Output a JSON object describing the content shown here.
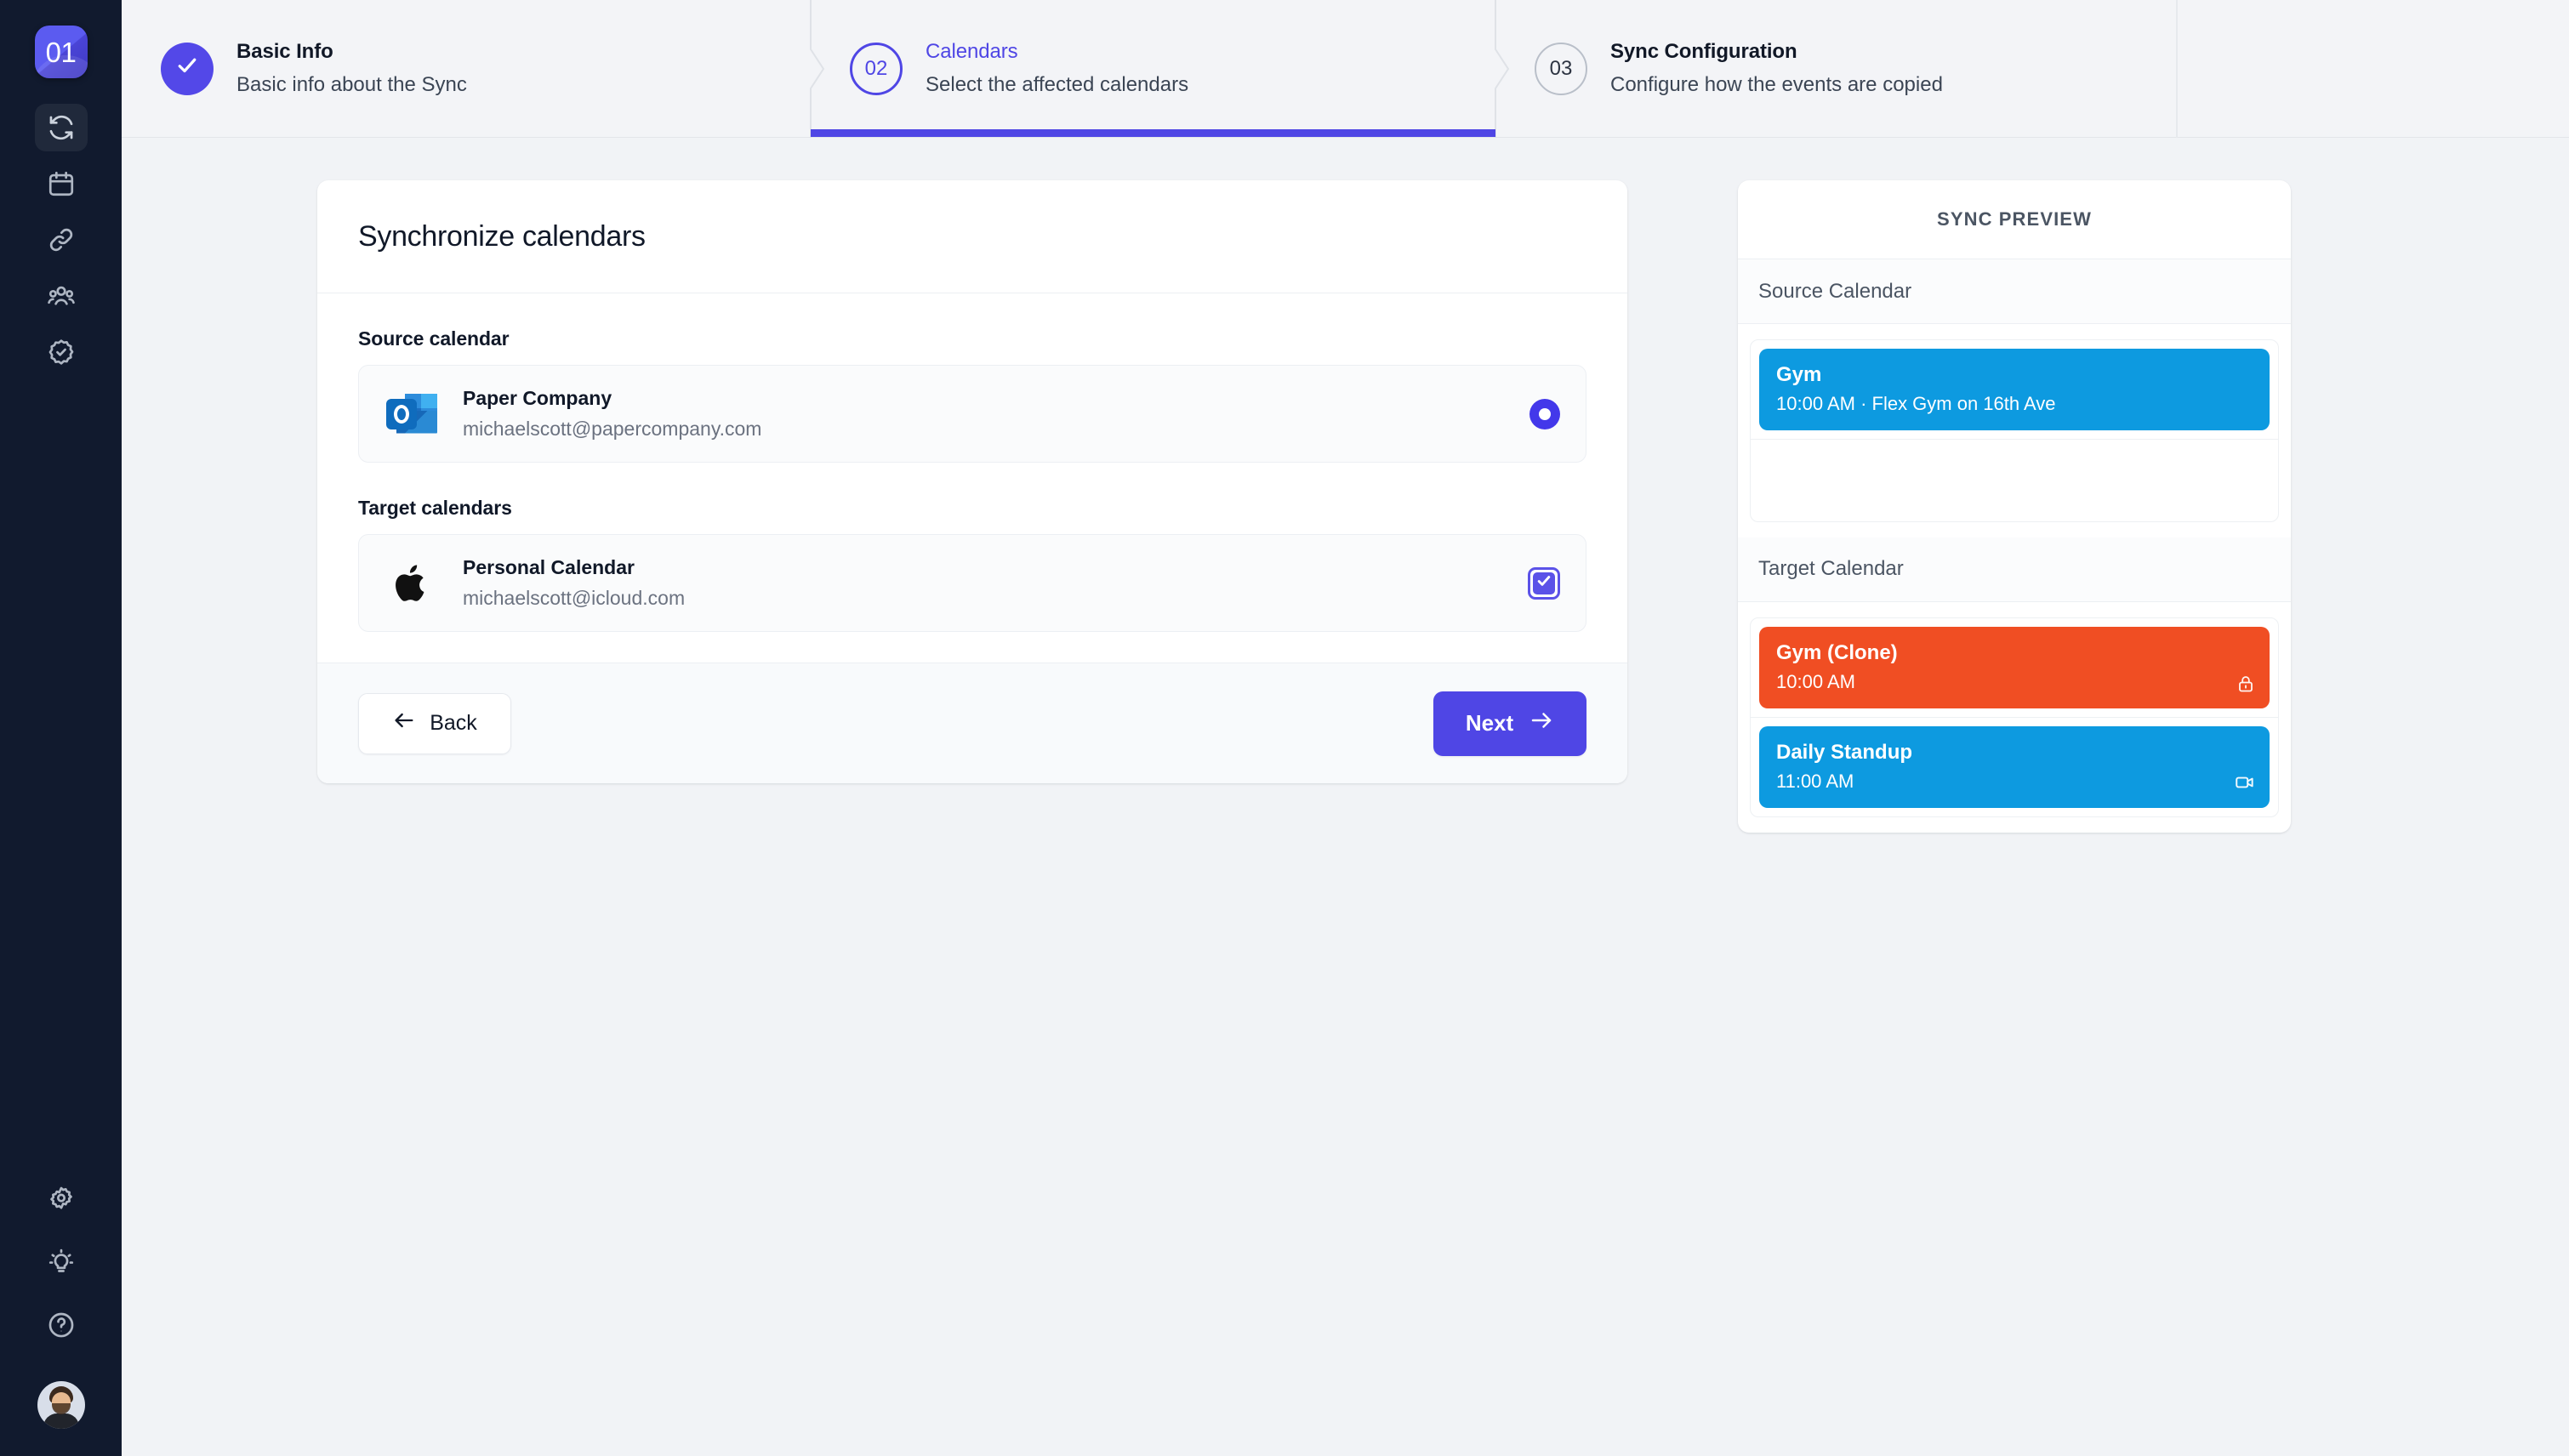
{
  "brand": {
    "logo_text": "01",
    "accent": "#4f46e5",
    "sidebar_bg": "#111a2e"
  },
  "sidebar": {
    "nav_top": [
      {
        "name": "sync-icon",
        "label": "Sync",
        "active": true
      },
      {
        "name": "calendar-icon",
        "label": "Calendars",
        "active": false
      },
      {
        "name": "link-icon",
        "label": "Connections",
        "active": false
      },
      {
        "name": "people-icon",
        "label": "Team",
        "active": false
      },
      {
        "name": "verified-badge-icon",
        "label": "Verified",
        "active": false
      }
    ],
    "nav_bottom": [
      {
        "name": "gear-icon",
        "label": "Settings"
      },
      {
        "name": "lightbulb-icon",
        "label": "Ideas"
      },
      {
        "name": "help-circle-icon",
        "label": "Help"
      }
    ],
    "avatar_label": "Account"
  },
  "stepper": {
    "steps": [
      {
        "number": "01",
        "state": "done",
        "title": "Basic Info",
        "subtitle": "Basic info about the Sync"
      },
      {
        "number": "02",
        "state": "current",
        "title": "Calendars",
        "subtitle": "Select the affected calendars"
      },
      {
        "number": "03",
        "state": "todo",
        "title": "Sync Configuration",
        "subtitle": "Configure how the events are copied"
      }
    ]
  },
  "card": {
    "title": "Synchronize calendars",
    "source_label": "Source calendar",
    "target_label": "Target calendars",
    "source_account": {
      "provider_icon": "outlook-icon",
      "name": "Paper Company",
      "email": "michaelscott@papercompany.com",
      "selected": true
    },
    "target_account": {
      "provider_icon": "apple-icon",
      "name": "Personal Calendar",
      "email": "michaelscott@icloud.com",
      "checked": true
    },
    "back_label": "Back",
    "next_label": "Next"
  },
  "preview": {
    "header": "SYNC PREVIEW",
    "source_section_label": "Source Calendar",
    "target_section_label": "Target Calendar",
    "source_events": [
      {
        "title": "Gym",
        "sub": "10:00 AM · Flex Gym on 16th Ave",
        "color": "#0d9ae0",
        "badge": ""
      }
    ],
    "target_events": [
      {
        "title": "Gym (Clone)",
        "sub": "10:00 AM",
        "color": "#f04e23",
        "badge": "lock-icon"
      },
      {
        "title": "Daily Standup",
        "sub": "11:00 AM",
        "color": "#0d9ae0",
        "badge": "video-camera-icon"
      }
    ]
  }
}
